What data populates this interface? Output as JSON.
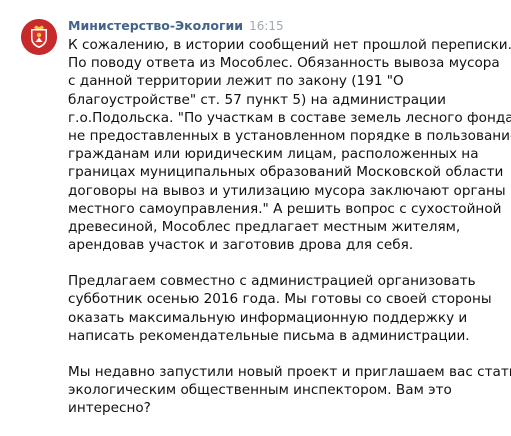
{
  "message": {
    "author": "Министерство-Экологии",
    "time": "16:15",
    "avatar": {
      "icon": "moscow-oblast-coat-of-arms-icon",
      "color": "#c62a2a"
    },
    "author_color": "#42648b",
    "paragraphs": [
      {
        "lines": [
          "К сожалению, в истории сообщений нет прошлой переписки.",
          "По поводу ответа из Мособлес. Обязанность вывоза мусора",
          "с данной территории лежит по закону (191 \"О",
          "благоустройстве\" ст. 57 пункт 5) на администрации",
          "г.о.Подольска. \"По участкам в составе земель лесного фонда,",
          "не предоставленных в установленном порядке в пользование",
          "гражданам или юридическим лицам, расположенных на",
          "границах муниципальных образований Московской области",
          "договоры на вывоз и утилизацию мусора заключают органы",
          "местного самоуправления.\" А решить вопрос с сухостойной",
          "древесиной, Мособлес предлагает местным жителям,",
          "арендовав участок и заготовив дрова для себя."
        ]
      },
      {
        "lines": [
          "Предлагаем совместно с администрацией организовать",
          "субботник осенью 2016 года. Мы готовы со своей стороны",
          "оказать максимальную информационную поддержку и",
          "написать рекомендательные письма в администрации."
        ]
      },
      {
        "lines": [
          "Мы недавно запустили новый проект и приглашаем вас стать",
          "экологическим общественным инспектором. Вам это",
          "интересно?"
        ]
      }
    ]
  }
}
